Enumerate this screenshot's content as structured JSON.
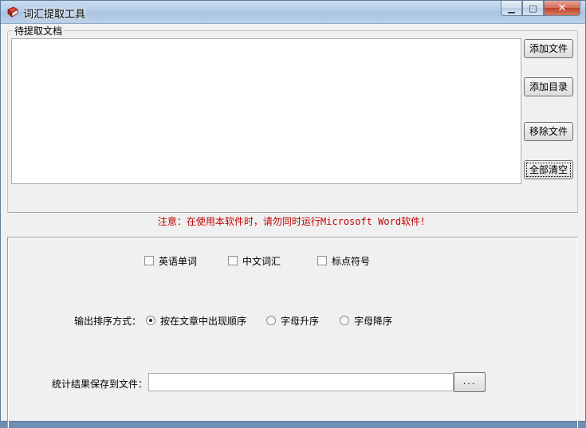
{
  "window": {
    "title": "词汇提取工具",
    "minimize_glyph": "▁",
    "maximize_glyph": "□",
    "close_glyph": "✕"
  },
  "documents": {
    "group_label": "待提取文档",
    "buttons": {
      "add_file": "添加文件",
      "add_folder": "添加目录",
      "remove_file": "移除文件",
      "clear_all": "全部清空"
    }
  },
  "notice": "注意：在使用本软件时，请勿同时运行Microsoft Word软件！",
  "extract_options": {
    "english_words": "英语单词",
    "chinese_words": "中文词汇",
    "punctuation": "标点符号"
  },
  "sort": {
    "label": "输出排序方式：",
    "options": [
      "按在文章中出现顺序",
      "字母升序",
      "字母降序"
    ],
    "selected": 0
  },
  "save": {
    "label": "统计结果保存到文件：",
    "value": "",
    "browse_label": "..."
  },
  "colors": {
    "notice": "#c00000",
    "titlebar": "#b6cde6",
    "close_button": "#c0412b"
  }
}
